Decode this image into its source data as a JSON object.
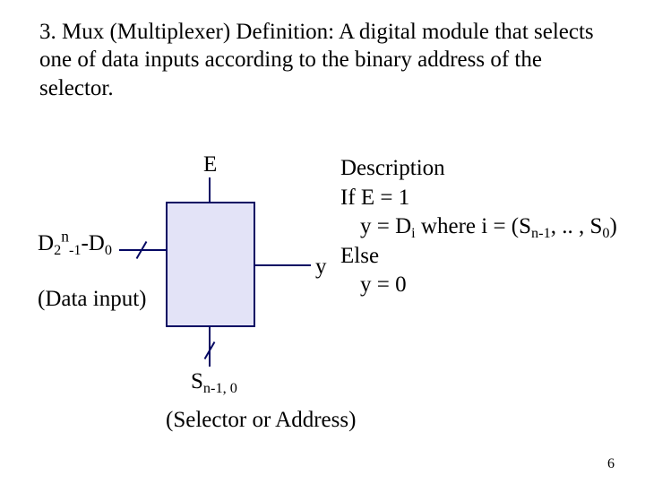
{
  "title": "3. Mux (Multiplexer) Definition: A digital module that selects one of data inputs according to the binary address of the selector.",
  "labels": {
    "E": "E",
    "y": "y",
    "D_prefix": "D",
    "D_sub1a": "2",
    "D_sup": "n",
    "D_sub1b": "-1",
    "D_mid": "-D",
    "D_sub2": "0",
    "data_input": "(Data input)",
    "S_prefix": "S",
    "S_sub": "n-1, 0",
    "selector": "(Selector or Address)"
  },
  "description": {
    "l1": "Description",
    "l2": "If E = 1",
    "l3a": "y = D",
    "l3b_sub": "i",
    "l3c": " where i = (S",
    "l3d_sub": "n-1",
    "l3e": ", .. , S",
    "l3f_sub": "0",
    "l3g": ")",
    "l4": "Else",
    "l5": "y = 0"
  },
  "page_number": "6"
}
